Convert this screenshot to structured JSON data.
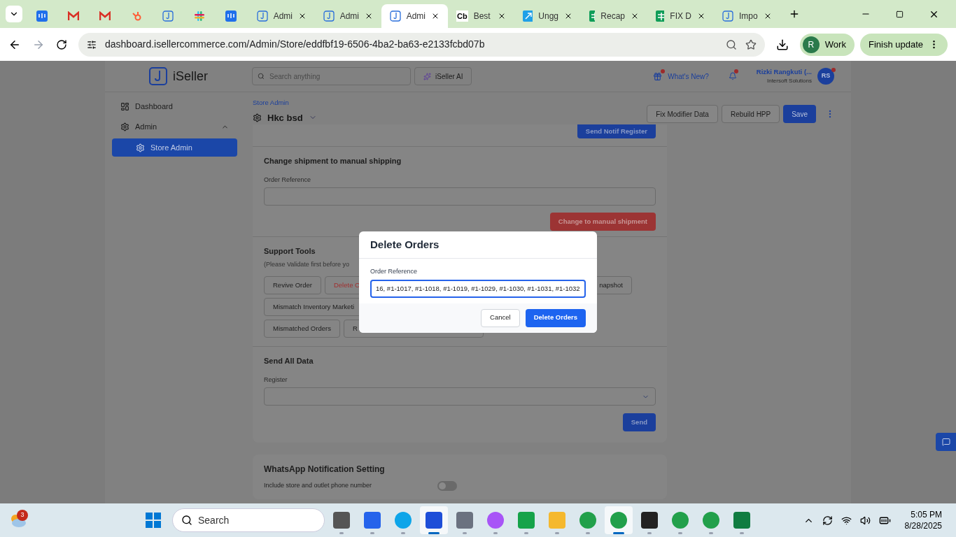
{
  "browser": {
    "tabs": [
      {
        "kind": "intercom",
        "selected": false
      },
      {
        "kind": "gmail",
        "selected": false
      },
      {
        "kind": "gmail",
        "selected": false
      },
      {
        "kind": "hubspot",
        "selected": false
      },
      {
        "kind": "iseller",
        "selected": false
      },
      {
        "kind": "slack",
        "selected": false
      },
      {
        "kind": "intercom",
        "selected": false
      },
      {
        "kind": "iseller",
        "title": "Admi",
        "selected": false
      },
      {
        "kind": "iseller",
        "title": "Admi",
        "selected": false
      },
      {
        "kind": "iseller",
        "title": "Admi",
        "selected": true
      },
      {
        "kind": "lettered",
        "icon_text": "Cb",
        "title": "Best",
        "selected": false
      },
      {
        "kind": "link",
        "title": "Ungg",
        "selected": false
      },
      {
        "kind": "sheets",
        "title": "Recap",
        "selected": false
      },
      {
        "kind": "sheets",
        "title": "FIX D",
        "selected": false
      },
      {
        "kind": "iseller",
        "title": "Impo",
        "selected": false
      }
    ],
    "url": "dashboard.isellercommerce.com/Admin/Store/eddfbf19-6506-4ba2-ba63-e2133fcbd07b",
    "profile": {
      "initial": "R",
      "label": "Work"
    },
    "update_button": "Finish update"
  },
  "header": {
    "logo": "iSeller",
    "search": {
      "placeholder": "Search anything"
    },
    "ai_button": "iSeller AI",
    "whats_new": "What's New?",
    "user": {
      "name": "Rizki Rangkuti (...",
      "company": "Intersoft Solutions",
      "initials": "RS"
    }
  },
  "sidebar": {
    "items": [
      {
        "label": "Dashboard",
        "kind": "dashboard",
        "selected": false
      },
      {
        "label": "Admin",
        "kind": "admin",
        "selected": false,
        "expanded": true,
        "children": [
          {
            "label": "Store Admin",
            "kind": "store",
            "selected": true
          }
        ]
      }
    ]
  },
  "page": {
    "breadcrumb": "Store Admin",
    "store": "Hkc bsd",
    "actions": [
      {
        "label": "Fix Modifier Data",
        "kind": "outline"
      },
      {
        "label": "Rebuild HPP",
        "kind": "outline"
      },
      {
        "label": "Save",
        "kind": "primary"
      }
    ]
  },
  "sections": {
    "notif_button": "Send Notif Register",
    "manual_shipping": {
      "title": "Change shipment to manual shipping",
      "label": "Order Reference",
      "button": "Change to manual shipment"
    },
    "support_tools": {
      "title": "Support Tools",
      "note": "(Please Validate first before yo",
      "rows": [
        [
          {
            "label": "Revive Order",
            "kind": "normal"
          },
          {
            "label": "Delete O",
            "kind": "danger"
          },
          {
            "label": "napshot",
            "kind": "tail"
          }
        ],
        [
          {
            "label": "Mismatch Inventory Marketi",
            "kind": "wide"
          }
        ],
        [
          {
            "label": "Mismatched Orders",
            "kind": "normal"
          },
          {
            "label": "R",
            "kind": "wide"
          }
        ]
      ]
    },
    "send_all": {
      "title": "Send All Data",
      "label": "Register",
      "button": "Send"
    },
    "whatsapp": {
      "title": "WhatsApp Notification Setting",
      "label": "Include store and outlet phone number",
      "on": false
    }
  },
  "modal": {
    "title": "Delete Orders",
    "label": "Order Reference",
    "value": "16, #1-1017, #1-1018, #1-1019, #1-1029, #1-1030, #1-1031, #1-1032",
    "cancel": "Cancel",
    "confirm": "Delete Orders"
  },
  "taskbar": {
    "widget_badge": "3",
    "search": "Search",
    "apps": [
      {
        "kind": "gallery",
        "active": false
      },
      {
        "kind": "store",
        "active": false
      },
      {
        "kind": "edge",
        "active": false
      },
      {
        "kind": "blue",
        "active": true
      },
      {
        "kind": "calculator",
        "active": false
      },
      {
        "kind": "copilot",
        "active": false
      },
      {
        "kind": "stack",
        "active": false
      },
      {
        "kind": "folder",
        "active": false
      },
      {
        "kind": "chrome",
        "active": false
      },
      {
        "kind": "chrome",
        "active": true
      },
      {
        "kind": "notes",
        "active": false
      },
      {
        "kind": "chrome",
        "active": false
      },
      {
        "kind": "chrome",
        "active": false
      },
      {
        "kind": "excel",
        "active": false
      }
    ],
    "time": "5:05 PM",
    "date": "8/28/2025"
  }
}
